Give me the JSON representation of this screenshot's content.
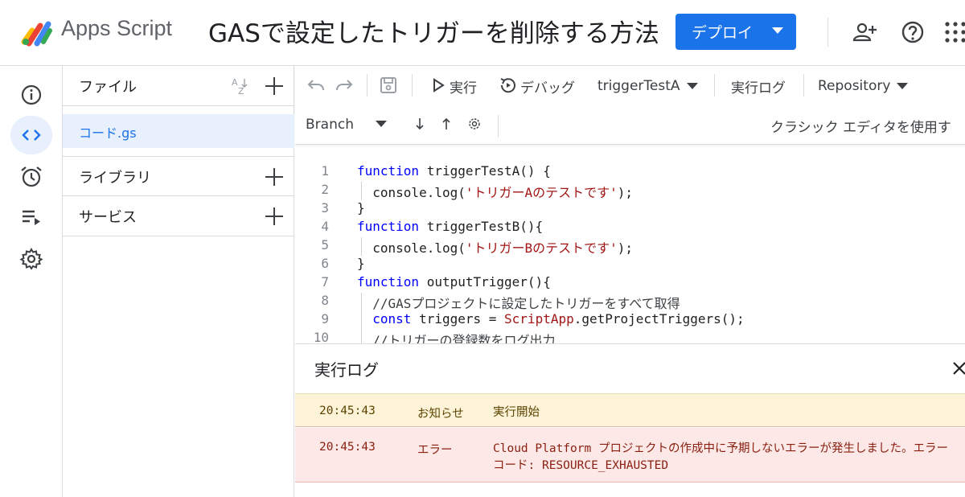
{
  "header": {
    "app_name": "Apps Script",
    "project_title": "GASで設定したトリガーを削除する方法",
    "deploy_label": "デプロイ",
    "icons": [
      "add-person-icon",
      "help-icon",
      "apps-grid-icon"
    ],
    "accent_color": "#1a73e8"
  },
  "rail": {
    "items": [
      {
        "name": "overview",
        "icon": "info-icon"
      },
      {
        "name": "editor",
        "icon": "code-icon",
        "active": true
      },
      {
        "name": "triggers",
        "icon": "alarm-icon"
      },
      {
        "name": "executions",
        "icon": "executions-icon"
      },
      {
        "name": "settings",
        "icon": "gear-icon"
      }
    ]
  },
  "files": {
    "title": "ファイル",
    "items": [
      "コード.gs"
    ],
    "libraries_label": "ライブラリ",
    "services_label": "サービス"
  },
  "toolbar": {
    "run_label": "実行",
    "debug_label": "デバッグ",
    "function_select": "triggerTestA",
    "exec_log_label": "実行ログ",
    "repository_label": "Repository",
    "branch_label": "Branch",
    "classic_editor_label": "クラシック エディタを使用す"
  },
  "code": {
    "lines": [
      {
        "n": "1",
        "parts": [
          {
            "t": "function",
            "c": "kw"
          },
          {
            "t": " triggerTestA() {",
            "c": ""
          }
        ]
      },
      {
        "n": "2",
        "indent": true,
        "parts": [
          {
            "t": "  console.log(",
            "c": ""
          },
          {
            "t": "'トリガーAのテストです'",
            "c": "str"
          },
          {
            "t": ");",
            "c": ""
          }
        ]
      },
      {
        "n": "3",
        "parts": [
          {
            "t": "}",
            "c": ""
          }
        ]
      },
      {
        "n": "4",
        "parts": [
          {
            "t": "function",
            "c": "kw"
          },
          {
            "t": " triggerTestB(){",
            "c": ""
          }
        ]
      },
      {
        "n": "5",
        "indent": true,
        "parts": [
          {
            "t": "  console.log(",
            "c": ""
          },
          {
            "t": "'トリガーBのテストです'",
            "c": "str"
          },
          {
            "t": ");",
            "c": ""
          }
        ]
      },
      {
        "n": "6",
        "parts": [
          {
            "t": "}",
            "c": ""
          }
        ]
      },
      {
        "n": "7",
        "parts": [
          {
            "t": "function",
            "c": "kw"
          },
          {
            "t": " outputTrigger(){",
            "c": ""
          }
        ]
      },
      {
        "n": "8",
        "indent": true,
        "parts": [
          {
            "t": "  //GASプロジェクトに設定したトリガーをすべて取得",
            "c": "cm"
          }
        ]
      },
      {
        "n": "9",
        "indent": true,
        "parts": [
          {
            "t": "  ",
            "c": ""
          },
          {
            "t": "const",
            "c": "kw"
          },
          {
            "t": " triggers = ",
            "c": ""
          },
          {
            "t": "ScriptApp",
            "c": "cls"
          },
          {
            "t": ".getProjectTriggers();",
            "c": ""
          }
        ]
      },
      {
        "n": "10",
        "indent": true,
        "parts": [
          {
            "t": "  //トリガーの登録数をログ出力",
            "c": "cm"
          }
        ]
      }
    ]
  },
  "log": {
    "title": "実行ログ",
    "entries": [
      {
        "time": "20:45:43",
        "level": "お知らせ",
        "message": "実行開始",
        "type": "info"
      },
      {
        "time": "20:45:43",
        "level": "エラー",
        "message": "Cloud Platform プロジェクトの作成中に予期しないエラーが発生しました。エラーコード: RESOURCE_EXHAUSTED",
        "type": "error"
      }
    ]
  }
}
